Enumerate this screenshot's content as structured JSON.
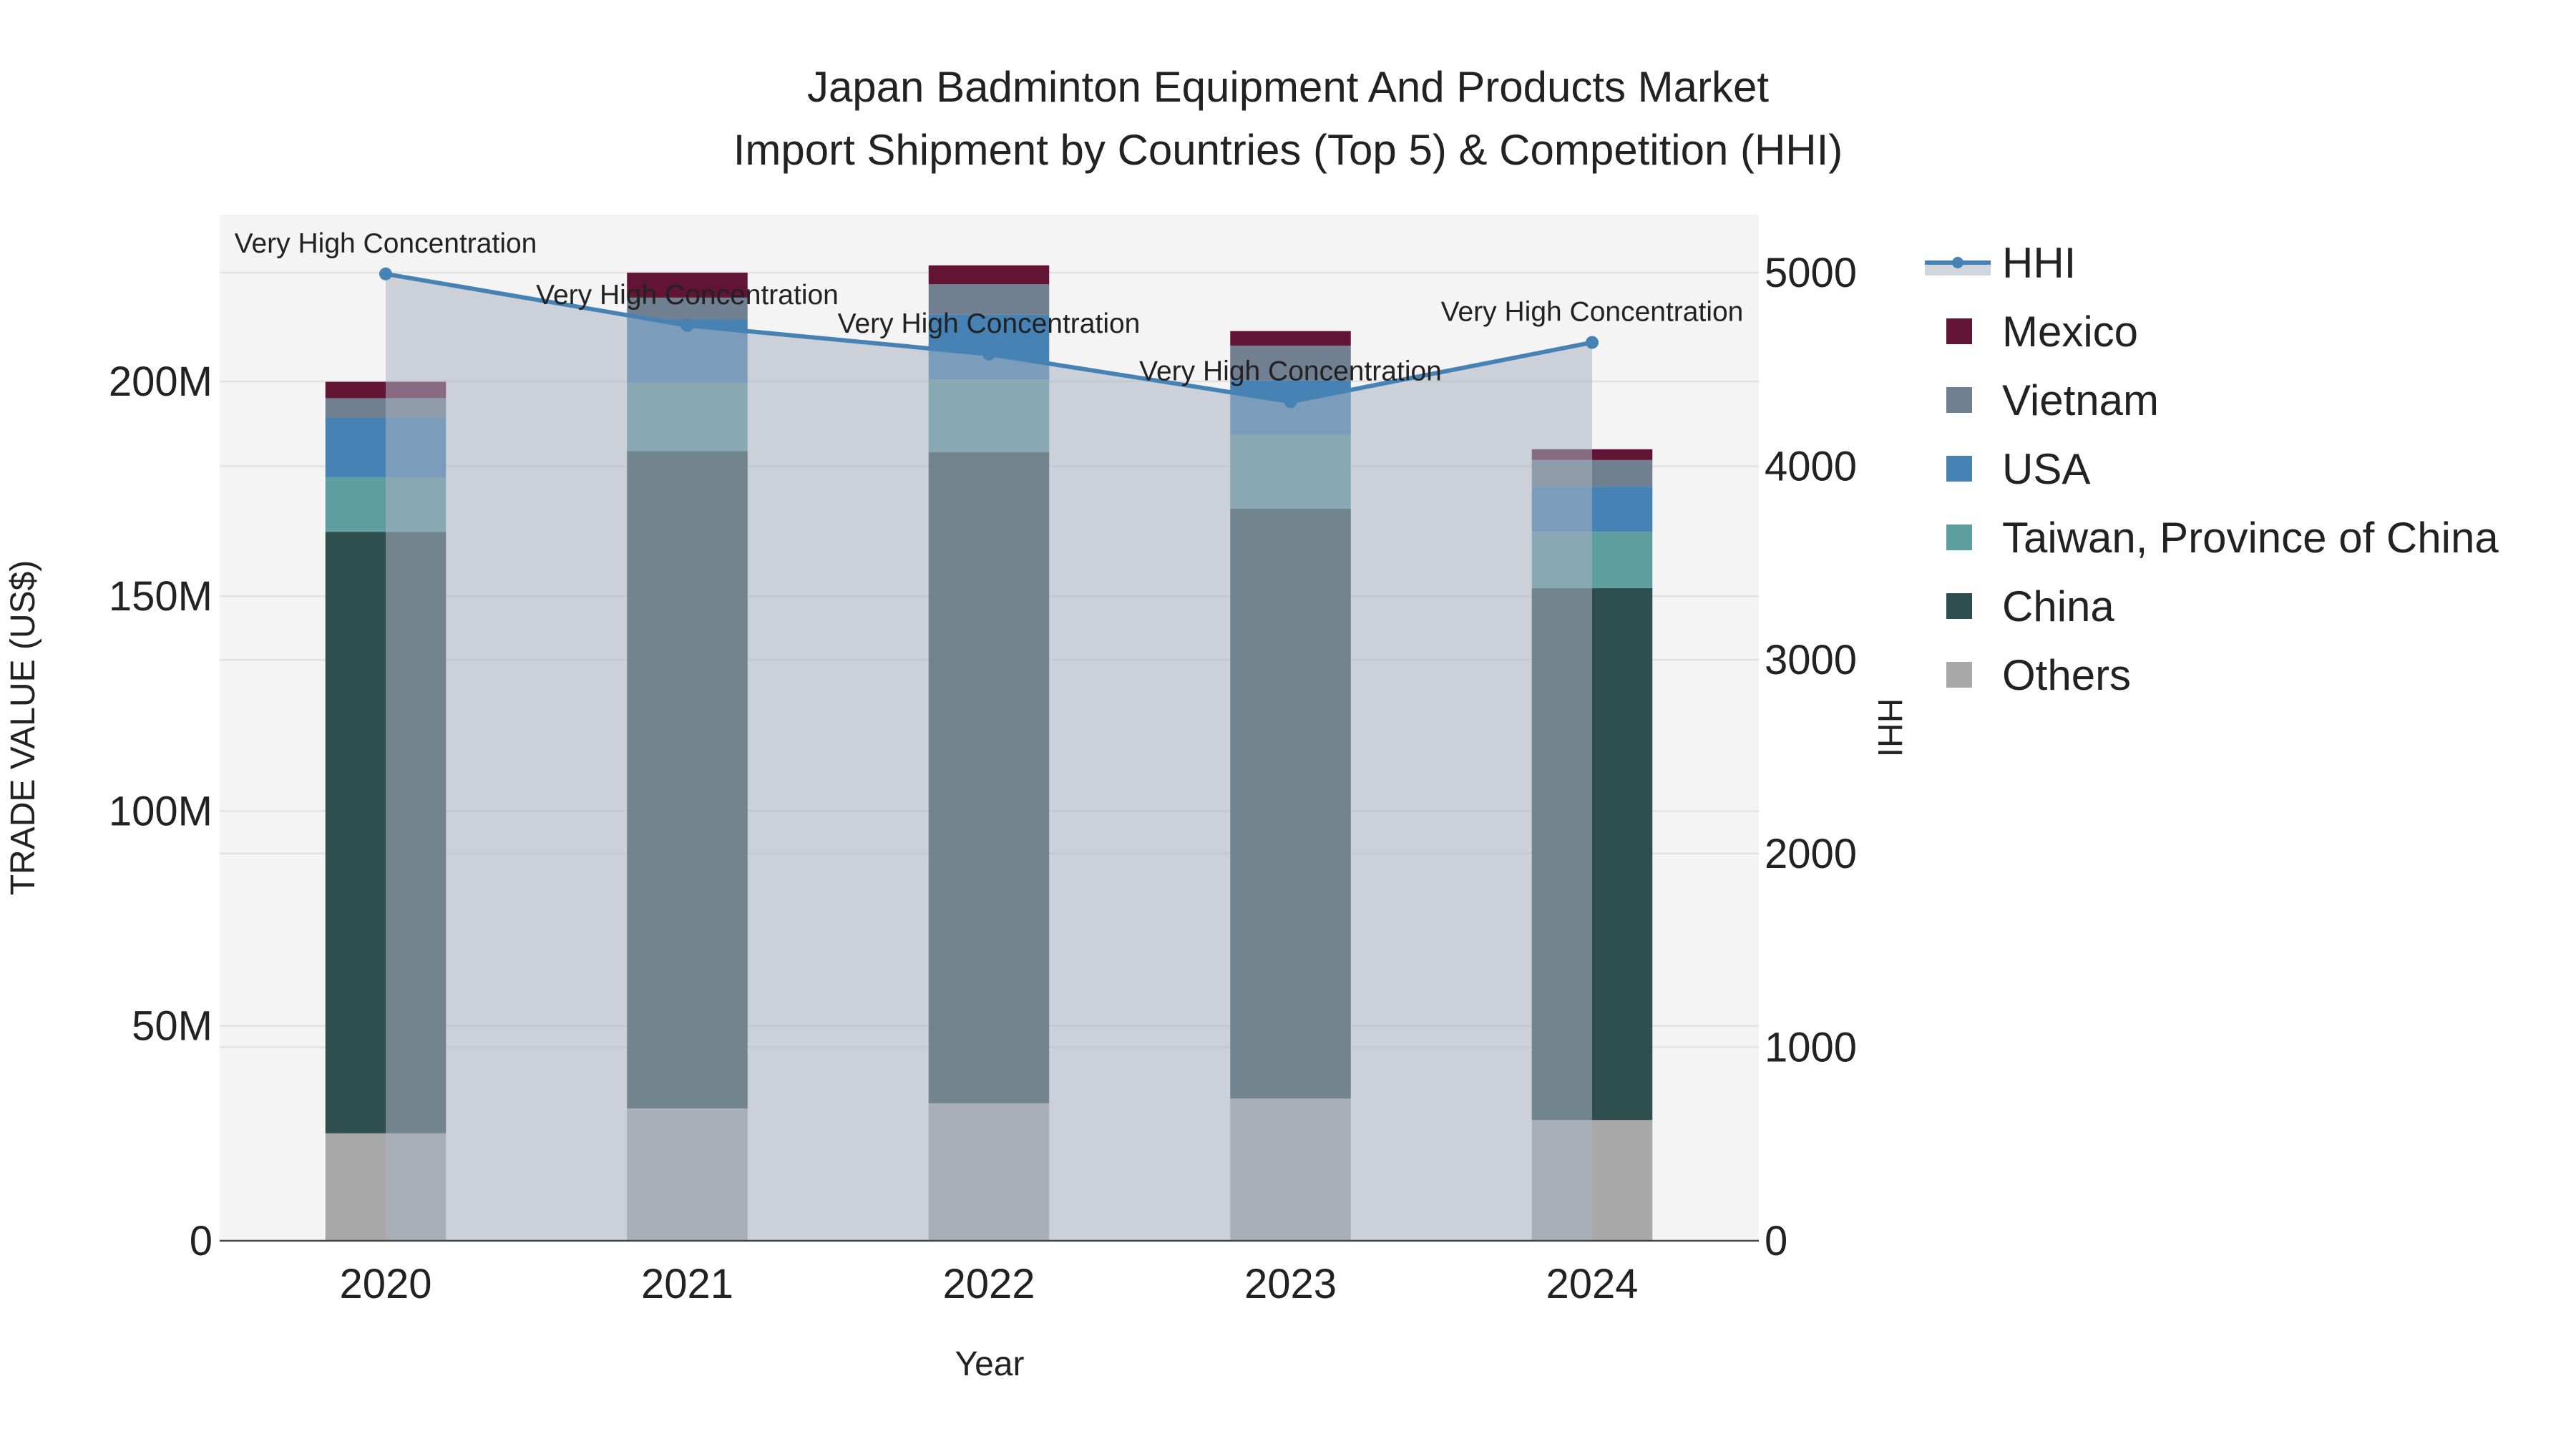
{
  "chart_data": {
    "type": "bar",
    "title_line1": "Japan Badminton Equipment And Products Market",
    "title_line2": "Import Shipment by Countries (Top 5) & Competition (HHI)",
    "xlabel": "Year",
    "ylabel": "TRADE VALUE (US$)",
    "y2label": "HHI",
    "categories": [
      "2020",
      "2021",
      "2022",
      "2023",
      "2024"
    ],
    "ylim": [
      0,
      238.8
    ],
    "y_unit": "M",
    "yticks": [
      0,
      50,
      100,
      150,
      200
    ],
    "ytick_labels": [
      "0",
      "50M",
      "100M",
      "150M",
      "200M"
    ],
    "y2lim": [
      0,
      5299
    ],
    "y2ticks": [
      0,
      1000,
      2000,
      3000,
      4000,
      5000
    ],
    "y2tick_labels": [
      "0",
      "1000",
      "2000",
      "3000",
      "4000",
      "5000"
    ],
    "series": [
      {
        "name": "Others",
        "color": "#A9A9A9",
        "values": [
          25.0,
          30.8,
          32.0,
          33.1,
          28.1
        ]
      },
      {
        "name": "China",
        "color": "#2F4F4F",
        "values": [
          140.0,
          153.0,
          151.5,
          137.3,
          123.8
        ]
      },
      {
        "name": "Taiwan, Province of China",
        "color": "#5F9EA0",
        "values": [
          12.7,
          15.9,
          17.0,
          17.2,
          13.1
        ]
      },
      {
        "name": "USA",
        "color": "#4682B4",
        "values": [
          13.8,
          14.7,
          15.0,
          12.6,
          10.5
        ]
      },
      {
        "name": "Vietnam",
        "color": "#708090",
        "values": [
          4.6,
          5.1,
          7.1,
          8.1,
          6.2
        ]
      },
      {
        "name": "Mexico",
        "color": "#611434",
        "values": [
          3.8,
          5.8,
          4.4,
          3.4,
          2.5
        ]
      }
    ],
    "hhi": {
      "name": "HHI",
      "color": "#4682B4",
      "values": [
        4993,
        4727,
        4579,
        4333,
        4639
      ],
      "annotations": [
        "Very High Concentration",
        "Very High Concentration",
        "Very High Concentration",
        "Very High Concentration",
        "Very High Concentration"
      ]
    },
    "legend": [
      "HHI",
      "Mexico",
      "Vietnam",
      "USA",
      "Taiwan, Province of China",
      "China",
      "Others"
    ],
    "legend_position": "right",
    "grid": true
  }
}
